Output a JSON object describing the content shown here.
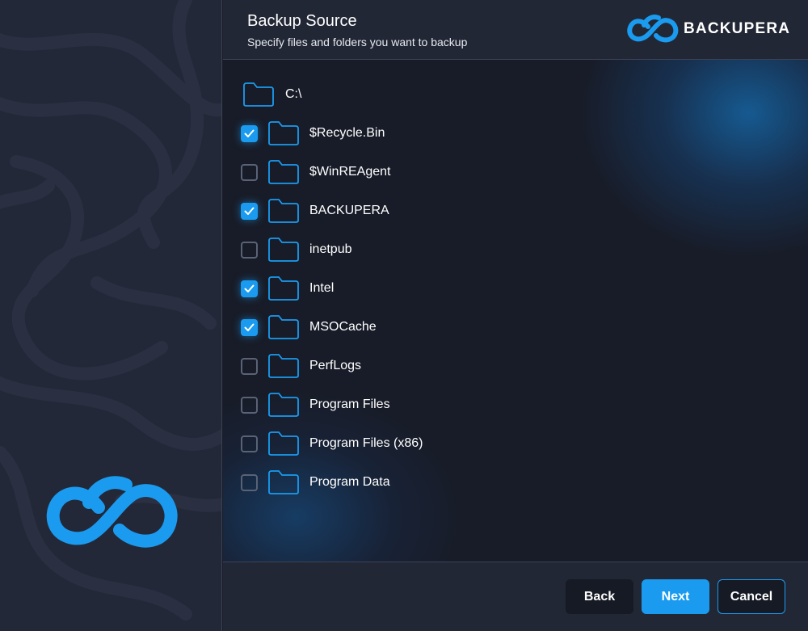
{
  "header": {
    "title": "Backup Source",
    "subtitle": "Specify files and folders you want to backup",
    "brand": "BACKUPERA"
  },
  "tree": {
    "root": {
      "label": "C:\\",
      "icon": "folder-icon"
    },
    "items": [
      {
        "label": "$Recycle.Bin",
        "checked": true
      },
      {
        "label": "$WinREAgent",
        "checked": false
      },
      {
        "label": "BACKUPERA",
        "checked": true
      },
      {
        "label": "inetpub",
        "checked": false
      },
      {
        "label": "Intel",
        "checked": true
      },
      {
        "label": "MSOCache",
        "checked": true
      },
      {
        "label": "PerfLogs",
        "checked": false
      },
      {
        "label": "Program Files",
        "checked": false
      },
      {
        "label": "Program Files (x86)",
        "checked": false
      },
      {
        "label": "Program Data",
        "checked": false
      }
    ]
  },
  "footer": {
    "back_label": "Back",
    "next_label": "Next",
    "cancel_label": "Cancel"
  },
  "colors": {
    "accent": "#1a9bf0",
    "background": "#181c28",
    "panel": "#222735"
  }
}
